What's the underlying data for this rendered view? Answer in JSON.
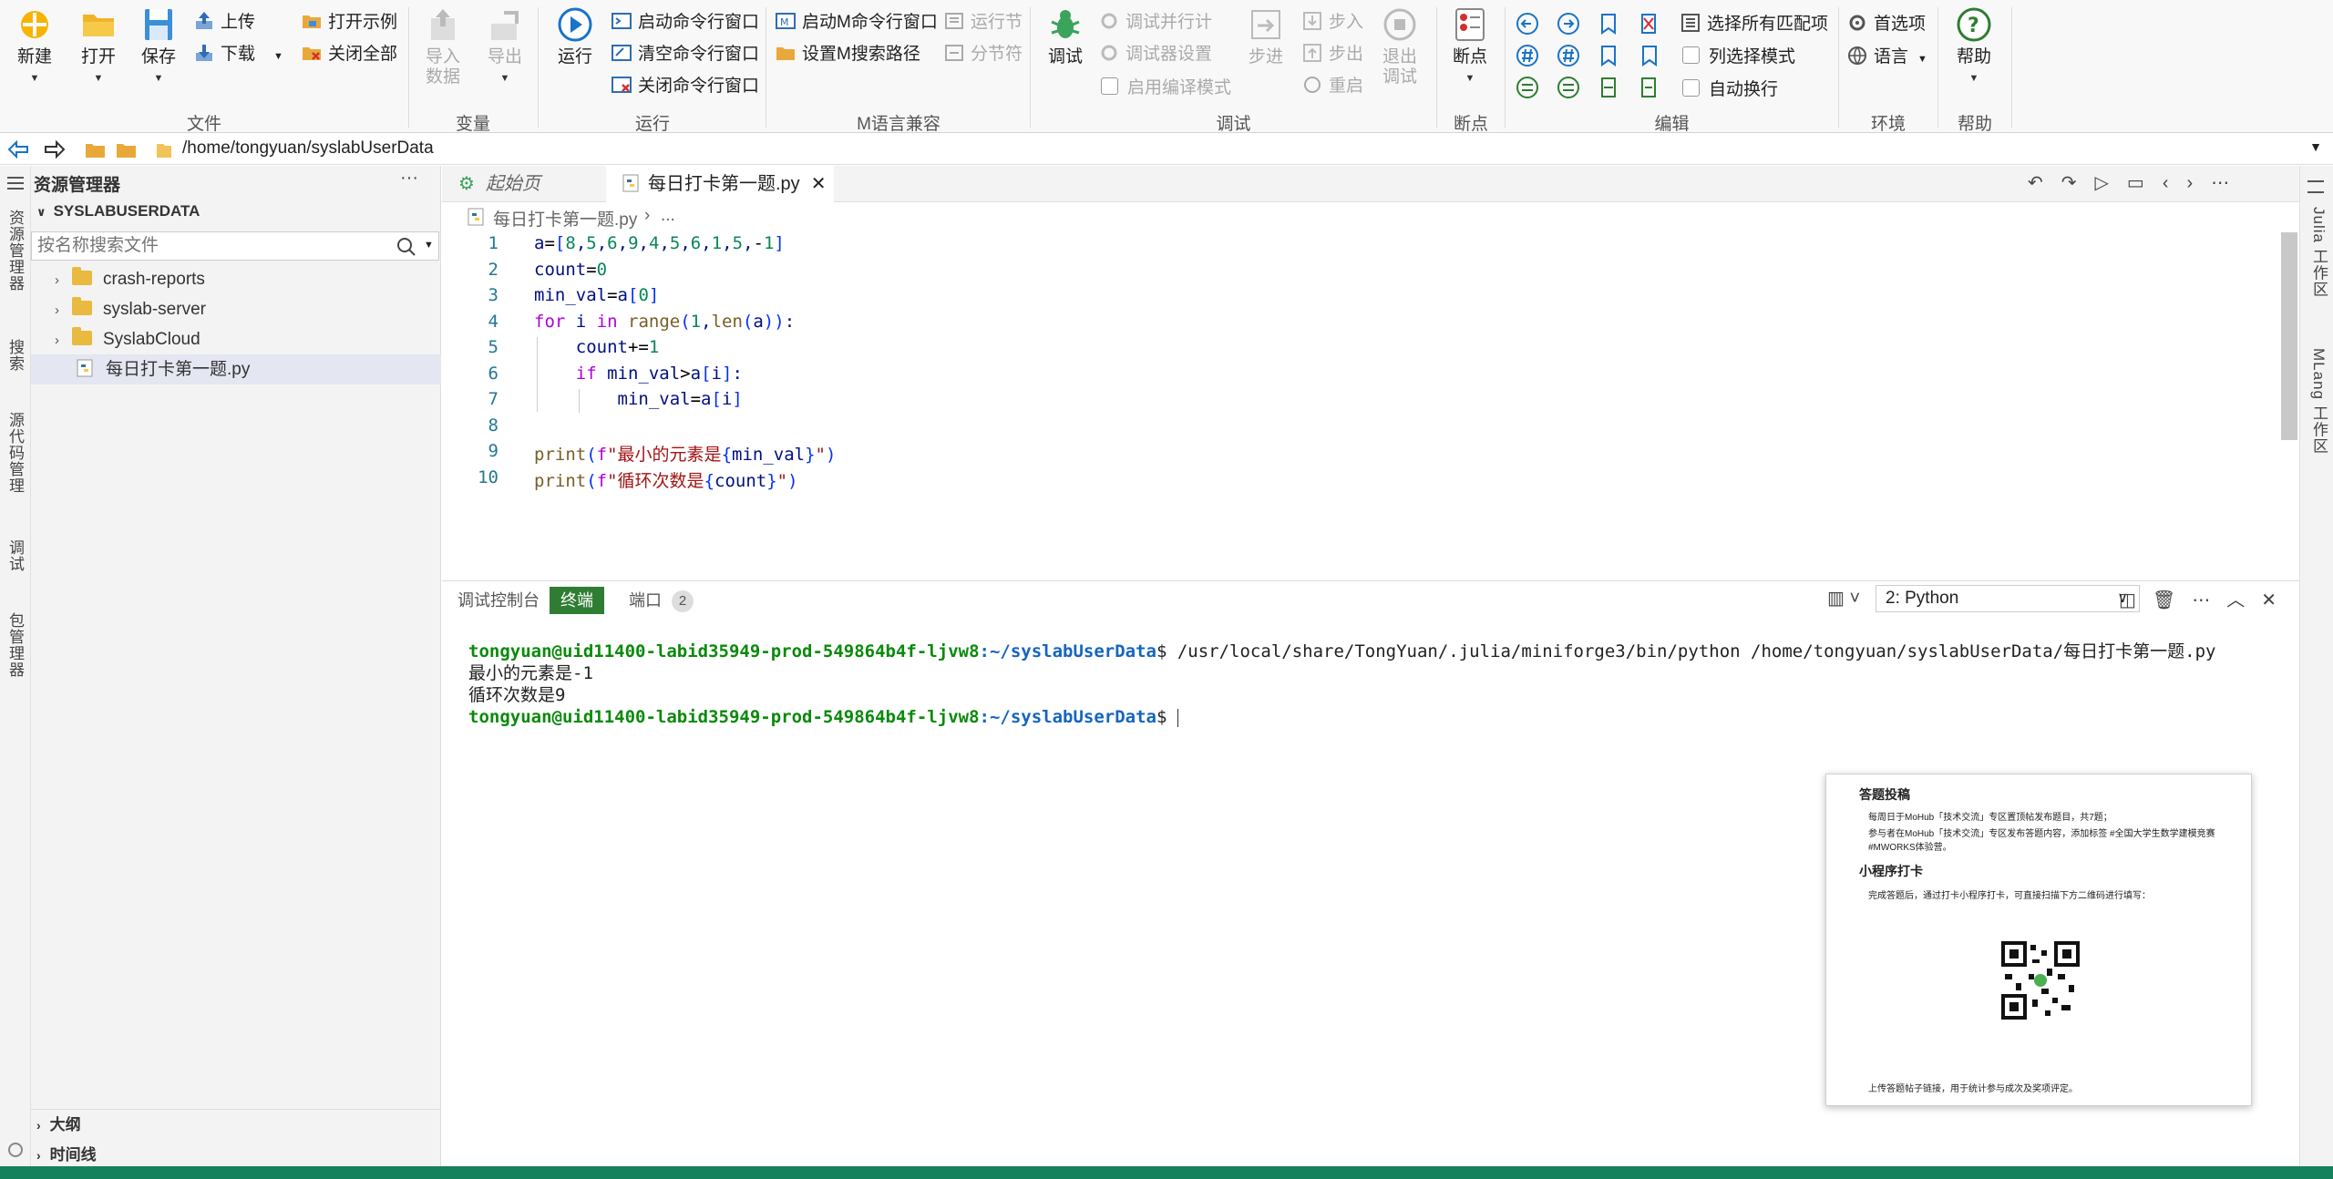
{
  "ribbon": {
    "file_group": {
      "label": "文件",
      "new": "新建",
      "open": "打开",
      "save": "保存",
      "upload": "上传",
      "download": "下载",
      "open_example": "打开示例",
      "close_all": "关闭全部"
    },
    "variable_group": {
      "label": "变量",
      "import_data": "导入\n数据",
      "export": "导出"
    },
    "run_group": {
      "label": "运行",
      "run": "运行",
      "start_cmd": "启动命令行窗口",
      "clear_cmd": "清空命令行窗口",
      "close_cmd": "关闭命令行窗口"
    },
    "m_group": {
      "label": "M语言兼容",
      "start_m_cmd": "启动M命令行窗口",
      "set_m_path": "设置M搜索路径",
      "run_section": "运行节",
      "split_section": "分节符"
    },
    "debug_group": {
      "label": "调试",
      "debug": "调试",
      "debug_parallel": "调试并行计",
      "debugger_settings": "调试器设置",
      "enable_compile": "启用编译模式",
      "step": "步进",
      "step_in": "步入",
      "step_out": "步出",
      "restart": "重启",
      "exit_debug": "退出\n调试"
    },
    "breakpoint_group": {
      "label": "断点",
      "breakpoint": "断点"
    },
    "edit_group": {
      "label": "编辑",
      "select_all_matches": "选择所有匹配项",
      "column_select": "列选择模式",
      "word_wrap": "自动换行"
    },
    "env_group": {
      "label": "环境",
      "preferences": "首选项",
      "language": "语言"
    },
    "help_group": {
      "label": "帮助",
      "help": "帮助"
    }
  },
  "address_bar": {
    "path": "/home/tongyuan/syslabUserData"
  },
  "activity_bar": {
    "explorer": "资源管理器",
    "search": "搜索",
    "source_control": "源代码管理",
    "debug": "调试",
    "packages": "包管理器"
  },
  "explorer": {
    "title": "资源管理器",
    "section": "SYSLABUSERDATA",
    "search_placeholder": "按名称搜索文件",
    "items": [
      {
        "name": "crash-reports"
      },
      {
        "name": "syslab-server"
      },
      {
        "name": "SyslabCloud"
      },
      {
        "name": "每日打卡第一题.py"
      }
    ],
    "outline": "大纲",
    "timeline": "时间线"
  },
  "editor": {
    "tabs": [
      {
        "label": "起始页"
      },
      {
        "label": "每日打卡第一题.py"
      }
    ],
    "breadcrumb": "每日打卡第一题.py",
    "breadcrumb_more": "...",
    "line_numbers": [
      "1",
      "2",
      "3",
      "4",
      "5",
      "6",
      "7",
      "8",
      "9",
      "10"
    ]
  },
  "panel": {
    "tabs": {
      "debug_console": "调试控制台",
      "terminal": "终端",
      "ports": "端口",
      "ports_count": "2"
    },
    "terminal_select": "2: Python",
    "terminal": {
      "prompt_user": "tongyuan@uid11400-labid35949-prod-549864b4f-ljvw8",
      "prompt_path": ":~/syslabUserData",
      "command": "$ /usr/local/share/TongYuan/.julia/miniforge3/bin/python /home/tongyuan/syslabUserData/每日打卡第一题.py",
      "output1": "最小的元素是-1",
      "output2": "循环次数是9",
      "prompt_end": "$ "
    }
  },
  "right_bar": {
    "julia": "Julia 工作区",
    "mlang": "MLang 工作区"
  },
  "overlay": {
    "heading1": "答题投稿",
    "bullet1": "每周日于MoHub「技术交流」专区置顶帖发布题目，共7题；",
    "bullet2": "参与者在MoHub「技术交流」专区发布答题内容，添加标签 #全国大学生数学建模竞赛 #MWORKS体验营。",
    "heading2": "小程序打卡",
    "bullet3": "完成答题后，通过打卡小程序打卡，可直接扫描下方二维码进行填写：",
    "bullet4": "上传答题帖子链接，用于统计参与成次及奖项评定。"
  },
  "colors": {
    "accent": "#1a73c7",
    "terminal_tab": "#2e7d32",
    "status_bar": "#16825d"
  }
}
